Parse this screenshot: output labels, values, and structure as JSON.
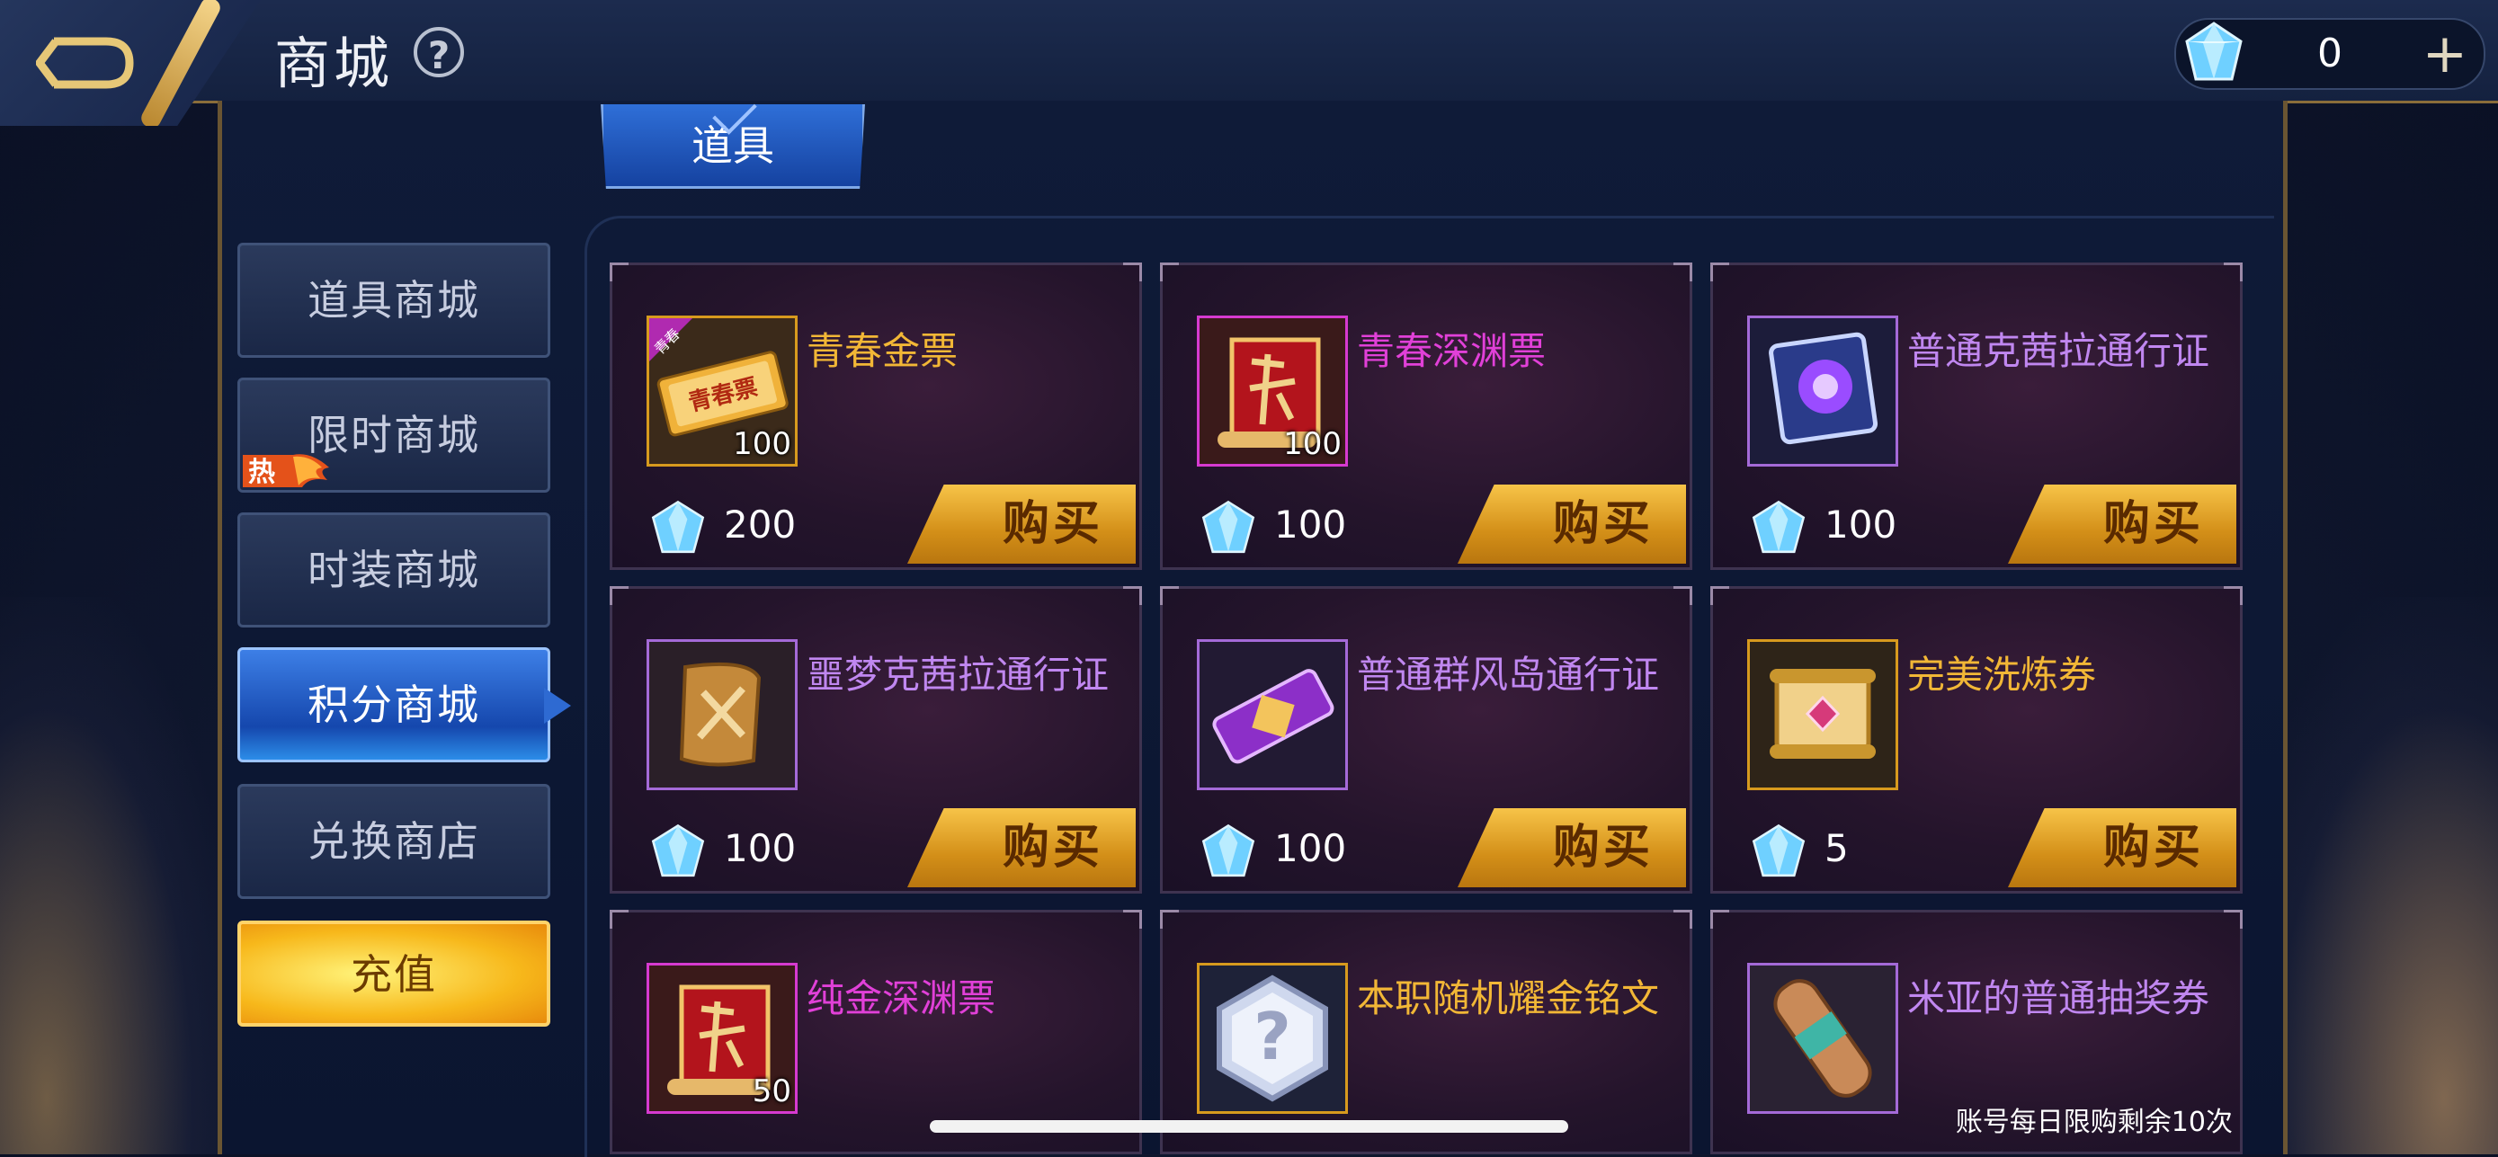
{
  "header": {
    "title": "商城",
    "help_glyph": "?",
    "currency_amount": "0",
    "plus_glyph": "+"
  },
  "tab": {
    "label": "道具"
  },
  "sidebar": {
    "items": [
      {
        "label": "道具商城"
      },
      {
        "label": "限时商城",
        "badge": "热"
      },
      {
        "label": "时装商城"
      },
      {
        "label": "积分商城",
        "active": true
      },
      {
        "label": "兑换商店"
      },
      {
        "label": "充值"
      }
    ]
  },
  "buy_label": "购买",
  "items": [
    {
      "name": "青春金票",
      "qty": "100",
      "price": "200",
      "rarity": "gold",
      "icon": "ticket-gold-icon",
      "icon_tag": "青春",
      "icon_text": "青春票"
    },
    {
      "name": "青春深渊票",
      "qty": "100",
      "price": "100",
      "rarity": "magenta",
      "icon": "abyss-scroll-icon"
    },
    {
      "name": "普通克茜拉通行证",
      "qty": "",
      "price": "100",
      "rarity": "violet",
      "icon": "pass-card-icon"
    },
    {
      "name": "噩梦克茜拉通行证",
      "qty": "",
      "price": "100",
      "rarity": "violet",
      "icon": "scroll-sword-icon"
    },
    {
      "name": "普通群风岛通行证",
      "qty": "",
      "price": "100",
      "rarity": "violet",
      "icon": "ticket-purple-icon"
    },
    {
      "name": "完美洗炼券",
      "qty": "",
      "price": "5",
      "rarity": "gold",
      "icon": "scroll-gem-icon"
    },
    {
      "name": "纯金深渊票",
      "qty": "50",
      "price": "",
      "rarity": "magenta",
      "icon": "abyss-scroll-icon"
    },
    {
      "name": "本职随机耀金铭文",
      "qty": "",
      "price": "",
      "rarity": "gold",
      "icon": "question-hex-icon"
    },
    {
      "name": "米亚的普通抽奖券",
      "qty": "",
      "price": "",
      "rarity": "violet",
      "icon": "scroll-roll-icon",
      "limit_note": "账号每日限购剩余10次"
    }
  ]
}
